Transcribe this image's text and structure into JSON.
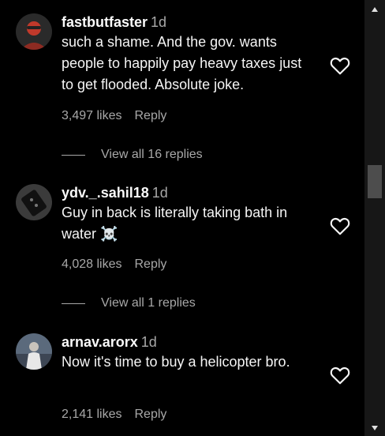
{
  "comments": [
    {
      "username": "fastbutfaster",
      "time": "1d",
      "text": "such a shame. And the gov. wants people to happily pay heavy taxes just to get flooded. Absolute joke.",
      "likes": "3,497 likes",
      "reply": "Reply",
      "view_replies": "View all 16 replies"
    },
    {
      "username": "ydv._.sahil18",
      "time": "1d",
      "text": "Guy in back is literally taking bath in water ☠️",
      "likes": "4,028 likes",
      "reply": "Reply",
      "view_replies": "View all 1 replies"
    },
    {
      "username": "arnav.arorx",
      "time": "1d",
      "text": "Now it's time to buy a helicopter bro.",
      "likes": "2,141 likes",
      "reply": "Reply"
    }
  ],
  "icons": {
    "like": "heart-outline-icon",
    "scroll_up": "triangle-up-icon",
    "scroll_down": "triangle-down-icon"
  },
  "colors": {
    "background": "#000000",
    "text": "#f5f5f5",
    "secondary_text": "#a8a8a8",
    "scrollbar_track": "#171717",
    "scrollbar_thumb": "#4d4d4d"
  }
}
